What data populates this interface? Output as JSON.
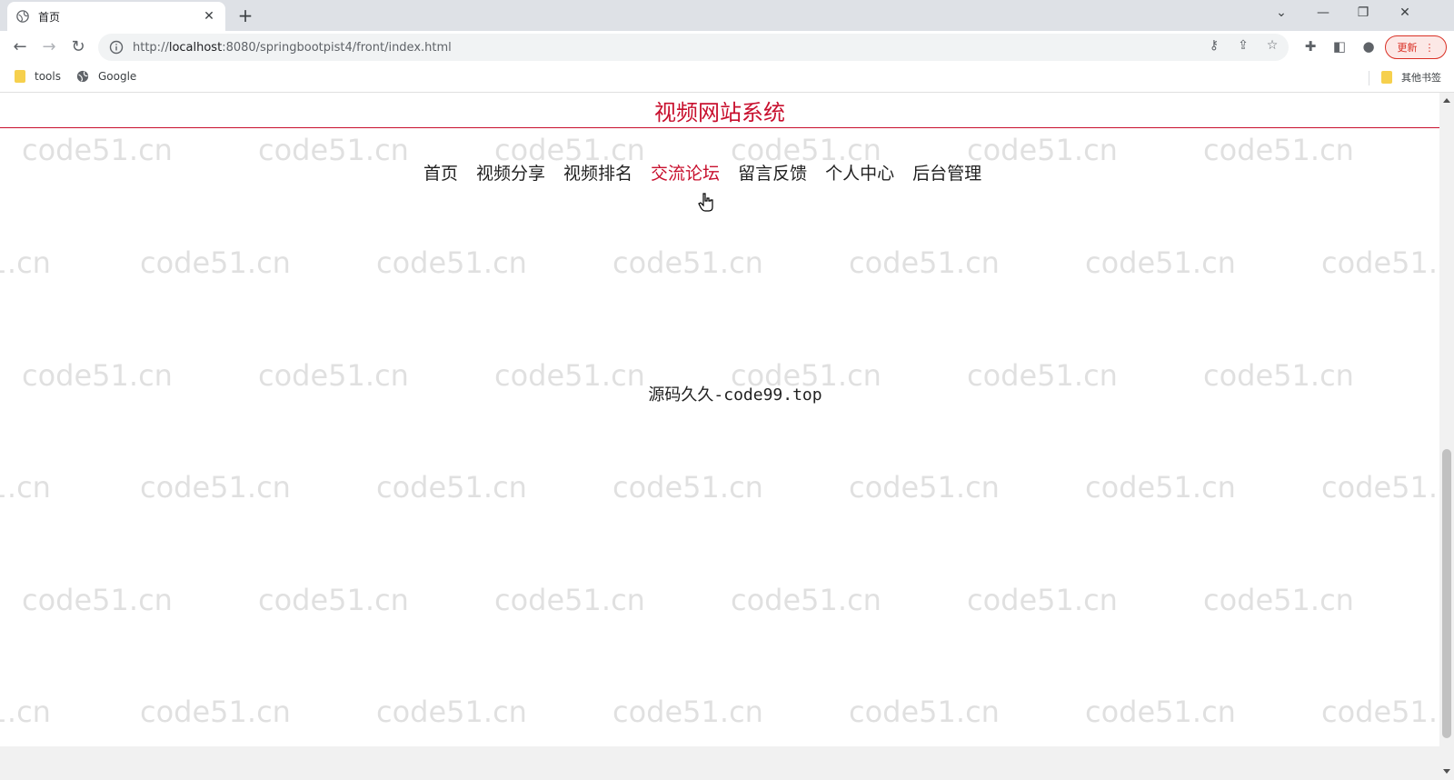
{
  "browser": {
    "tab_title": "首页",
    "url_prefix": "http://",
    "url_host": "localhost",
    "url_rest": ":8080/springbootpist4/front/index.html",
    "update_label": "更新",
    "bookmarks": [
      {
        "label": "tools",
        "icon": "folder-icon"
      },
      {
        "label": "Google",
        "icon": "globe-icon"
      }
    ],
    "other_bookmarks": "其他书签"
  },
  "site": {
    "title": "视频网站系统",
    "accent_color": "#c8102e",
    "nav": [
      {
        "label": "首页",
        "active": false
      },
      {
        "label": "视频分享",
        "active": false
      },
      {
        "label": "视频排名",
        "active": false
      },
      {
        "label": "交流论坛",
        "active": true
      },
      {
        "label": "留言反馈",
        "active": false
      },
      {
        "label": "个人中心",
        "active": false
      },
      {
        "label": "后台管理",
        "active": false
      }
    ],
    "footer": "源码久久-code99.top"
  },
  "watermark": "code51.cn"
}
